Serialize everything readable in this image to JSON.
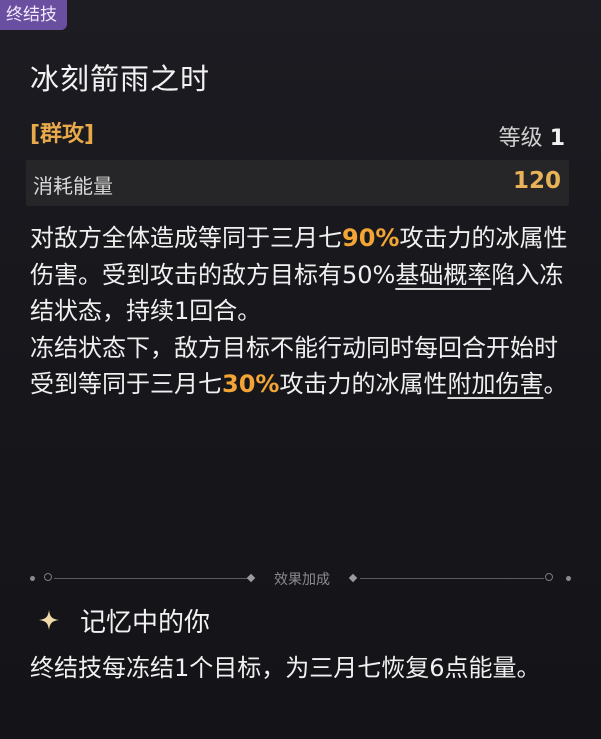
{
  "skill": {
    "tag": "终结技",
    "name": "冰刻箭雨之时",
    "attack_type": "[群攻]",
    "level_label": "等级",
    "level_value": "1",
    "energy_label": "消耗能量",
    "energy_value": "120"
  },
  "description": {
    "p1_a": "对敌方全体造成等同于三月七",
    "p1_pct": "90%",
    "p1_b": "攻击力的冰属性伤害。受到攻击的敌方目标有",
    "p1_pct2": "50%",
    "p1_link": "基础概率",
    "p1_c": "陷入冻结状态，持续1回合。",
    "p2_a": "冻结状态下，敌方目标不能行动同时每回合开始时受到等同于三月七",
    "p2_pct": "30%",
    "p2_b": "攻击力的冰属性",
    "p2_link": "附加伤害",
    "p2_c": "。"
  },
  "bonus": {
    "section_label": "效果加成",
    "trace_name": "记忆中的你",
    "trace_desc": "终结技每冻结1个目标，为三月七恢复6点能量。",
    "star_icon": "sparkle-star-icon"
  },
  "colors": {
    "tag_bg": "#6a4fa0",
    "highlight": "#f2a535",
    "attack_type": "#e8a94a"
  }
}
